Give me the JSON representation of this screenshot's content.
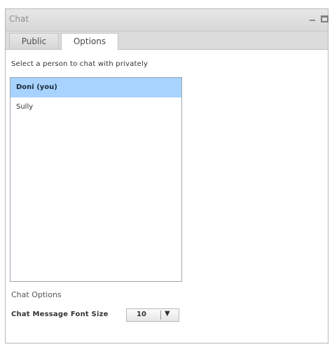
{
  "window": {
    "title": "Chat"
  },
  "tabs": [
    {
      "label": "Public"
    },
    {
      "label": "Options"
    }
  ],
  "options": {
    "prompt": "Select a person to chat with privately",
    "people": [
      {
        "name": "Doni (you)",
        "selected": true
      },
      {
        "name": "Sully",
        "selected": false
      }
    ],
    "section_heading": "Chat Options",
    "font_size_label": "Chat Message Font Size",
    "font_size_value": "10",
    "dropdown_arrow": "▼"
  },
  "colors": {
    "selected_row": "#a8d3ff"
  },
  "icons": {
    "minimize": "minimize-icon",
    "maximize": "maximize-icon",
    "dropdown": "chevron-down-icon"
  }
}
